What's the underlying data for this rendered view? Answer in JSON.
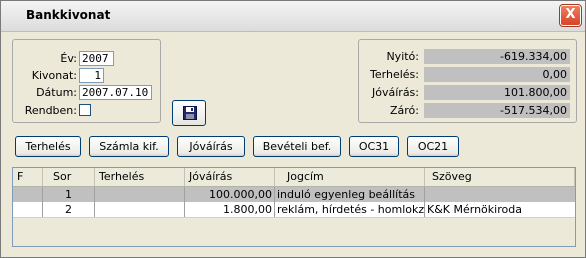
{
  "window": {
    "title": "Bankkivonat",
    "close_glyph": "X"
  },
  "form": {
    "ev_label": "Év:",
    "ev_value": "2007",
    "kivonat_label": "Kivonat:",
    "kivonat_value": "1",
    "datum_label": "Dátum:",
    "datum_value": "2007.07.10",
    "rendben_label": "Rendben:",
    "rendben_checked": false,
    "save_icon": "floppy-disk-icon"
  },
  "summary": {
    "nyito_label": "Nyitó:",
    "nyito_value": "-619.334,00",
    "terheles_label": "Terhelés:",
    "terheles_value": "0,00",
    "jovairas_label": "Jóváírás:",
    "jovairas_value": "101.800,00",
    "zaro_label": "Záró:",
    "zaro_value": "-517.534,00"
  },
  "toolbar": {
    "terheles": "Terhelés",
    "szamla": "Számla kif.",
    "jovairas": "Jóváírás",
    "beveteli": "Bevételi bef.",
    "oc31": "OC31",
    "oc21": "OC21"
  },
  "table": {
    "headers": [
      "F",
      "Sor",
      "Terhelés",
      "Jóváírás",
      "Jogcím",
      "Szöveg"
    ],
    "rows": [
      {
        "f": "",
        "sor": "1",
        "terheles": "",
        "jovairas": "100.000,00",
        "jogcim": "induló egyenleg beállítás",
        "szoveg": "",
        "selected": true
      },
      {
        "f": "",
        "sor": "2",
        "terheles": "",
        "jovairas": "1.800,00",
        "jogcim": "reklám, hírdetés - homlokzati",
        "szoveg": "K&K Mérnökiroda",
        "selected": false
      }
    ]
  },
  "colors": {
    "selected_row": "#c0c0c0",
    "readonly_field": "#c0c0c0",
    "close_button": "#d5452a",
    "button_border": "#003c74"
  }
}
